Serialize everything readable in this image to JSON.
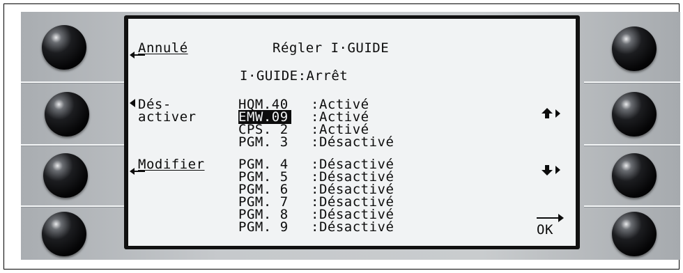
{
  "screen": {
    "title": "Régler I·GUIDE",
    "status": "I·GUIDE:Arrêt",
    "soft_keys_left": {
      "cancel": "Annulé",
      "deactivate_line1": "Dés-",
      "deactivate_line2": "activer",
      "modify": "Modifier"
    },
    "soft_keys_right": {
      "up": "up-arrow",
      "down": "down-arrow",
      "ok": "OK"
    },
    "programs": [
      {
        "name": "HQM.40",
        "state": ":Activé"
      },
      {
        "name": "EMW.09",
        "state": ":Activé"
      },
      {
        "name": "CPS. 2",
        "state": ":Activé"
      },
      {
        "name": "PGM. 3",
        "state": ":Désactivé"
      },
      {
        "name": "PGM. 4",
        "state": ":Désactivé"
      },
      {
        "name": "PGM. 5",
        "state": ":Désactivé"
      },
      {
        "name": "PGM. 6",
        "state": ":Désactivé"
      },
      {
        "name": "PGM. 7",
        "state": ":Désactivé"
      },
      {
        "name": "PGM. 8",
        "state": ":Désactivé"
      },
      {
        "name": "PGM. 9",
        "state": ":Désactivé"
      }
    ],
    "selected_index": 1
  }
}
